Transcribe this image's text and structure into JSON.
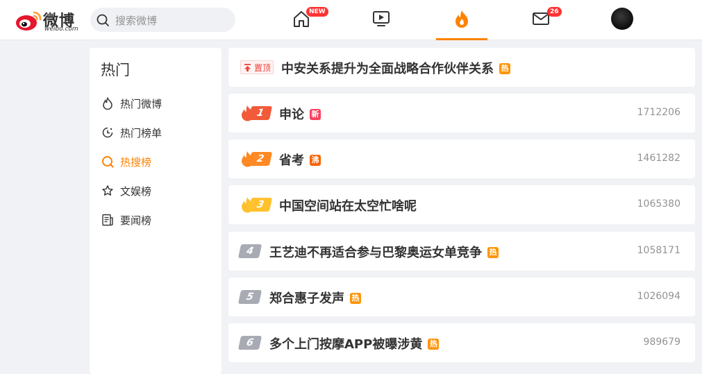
{
  "header": {
    "logo_text": "微博",
    "logo_sub": "weibo.com",
    "search_placeholder": "搜索微博",
    "nav": {
      "home_badge": "NEW",
      "messages_badge": "26"
    }
  },
  "sidebar": {
    "title": "热门",
    "items": [
      {
        "label": "热门微博",
        "icon": "flame-outline-icon",
        "active": false
      },
      {
        "label": "热门榜单",
        "icon": "clock-chart-icon",
        "active": false
      },
      {
        "label": "热搜榜",
        "icon": "search-circle-icon",
        "active": true
      },
      {
        "label": "文娱榜",
        "icon": "star-icon",
        "active": false
      },
      {
        "label": "要闻榜",
        "icon": "news-icon",
        "active": false
      }
    ]
  },
  "hot_list": {
    "pinned": {
      "label": "置顶",
      "title": "中安关系提升为全面战略合作伙伴关系",
      "tag": "热"
    },
    "items": [
      {
        "rank": "1",
        "title": "申论",
        "tag": "新",
        "tag_color": "#f9415b",
        "count": "1712206"
      },
      {
        "rank": "2",
        "title": "省考",
        "tag": "沸",
        "tag_color": "#f86400",
        "count": "1461282"
      },
      {
        "rank": "3",
        "title": "中国空间站在太空忙啥呢",
        "tag": "",
        "tag_color": "",
        "count": "1065380"
      },
      {
        "rank": "4",
        "title": "王艺迪不再适合参与巴黎奥运女单竞争",
        "tag": "热",
        "tag_color": "#ff9406",
        "count": "1058171"
      },
      {
        "rank": "5",
        "title": "郑合惠子发声",
        "tag": "热",
        "tag_color": "#ff9406",
        "count": "1026094"
      },
      {
        "rank": "6",
        "title": "多个上门按摩APP被曝涉黄",
        "tag": "热",
        "tag_color": "#ff9406",
        "count": "989679"
      }
    ]
  },
  "colors": {
    "accent": "#ff8200",
    "rank1": "#f35a3a",
    "rank2": "#ff8a25",
    "rank3": "#ffc12d",
    "rank_plain": "#a9abb4"
  }
}
